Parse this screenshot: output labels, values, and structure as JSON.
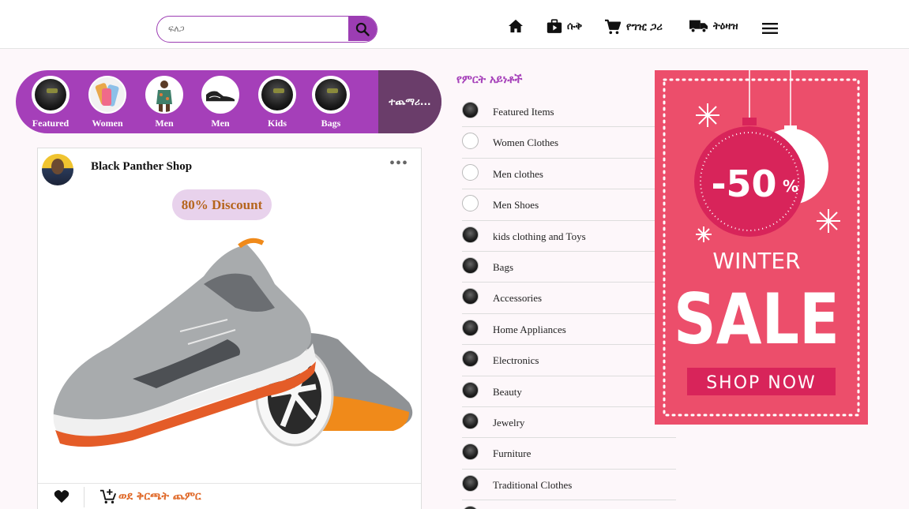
{
  "header": {
    "search": {
      "placeholder": "ፍለጋ"
    },
    "nav": [
      {
        "icon": "home-icon",
        "label": ""
      },
      {
        "icon": "shop-icon",
        "label": "ሱቅ"
      },
      {
        "icon": "cart-icon",
        "label": "የግዢ ጋሪ"
      },
      {
        "icon": "truck-icon",
        "label": "ትዕዛዝ"
      },
      {
        "icon": "menu-icon",
        "label": ""
      }
    ]
  },
  "stories": {
    "items": [
      {
        "label": "Featured"
      },
      {
        "label": "Women"
      },
      {
        "label": "Men"
      },
      {
        "label": "Men"
      },
      {
        "label": "Kids"
      },
      {
        "label": "Bags"
      }
    ],
    "more_label": "ተጨማሪ..."
  },
  "post": {
    "shop_name": "Black Panther Shop",
    "discount": "80% Discount",
    "add_to_cart_label": "ወደ ቅርጫት ጨምር"
  },
  "categories": {
    "title": "የምርት አይነቶች",
    "items": [
      "Featured Items",
      "Women Clothes",
      "Men clothes",
      "Men Shoes",
      "kids clothing and Toys",
      "Bags",
      "Accessories",
      "Home Appliances",
      "Electronics",
      "Beauty",
      "Jewelry",
      "Furniture",
      "Traditional Clothes"
    ]
  },
  "ad": {
    "discount": "-50",
    "percent": "%",
    "line1": "WINTER",
    "line2": "SALE",
    "cta": "SHOP NOW",
    "colors": {
      "background": "#ec4e6b",
      "ornament": "#d8245a"
    }
  },
  "colors": {
    "accent": "#a53fb9",
    "cart_text": "#e06a2a",
    "discount_text": "#b5651d"
  }
}
